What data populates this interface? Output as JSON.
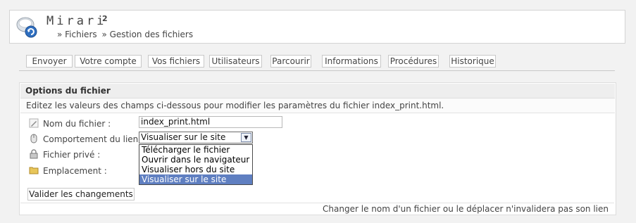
{
  "app": {
    "title": "Mirari",
    "superscript": "2"
  },
  "breadcrumb": [
    "» Fichiers",
    "» Gestion des fichiers"
  ],
  "tabs": [
    {
      "label": "Envoyer"
    },
    {
      "label": "Votre compte"
    },
    {
      "label": "Vos fichiers"
    },
    {
      "label": "Utilisateurs"
    },
    {
      "label": "Parcourir"
    },
    {
      "label": "Informations"
    },
    {
      "label": "Procédures"
    },
    {
      "label": "Historique"
    }
  ],
  "panel": {
    "title": "Options du fichier",
    "description": "Editez les valeurs des champs ci-dessous pour modifier les paramètres du fichier index_print.html.",
    "fields": {
      "filename": {
        "label": "Nom du fichier :",
        "value": "index_print.html",
        "icon": "pencil-icon"
      },
      "link_behavior": {
        "label": "Comportement du lien :",
        "icon": "mouse-icon",
        "selected": "Visualiser sur le site",
        "options": [
          "Télécharger le fichier",
          "Ouvrir dans le navigateur",
          "Visualiser hors du site",
          "Visualiser sur le site"
        ],
        "highlighted_index": 3
      },
      "private": {
        "label": "Fichier privé :",
        "icon": "lock-icon"
      },
      "location": {
        "label": "Emplacement :",
        "icon": "folder-icon"
      }
    },
    "submit_label": "Valider les changements",
    "footnote": "Changer le nom d'un fichier ou le déplacer n'invalidera pas son lien"
  },
  "colors": {
    "selection": "#5f7fc1",
    "background": "#f2f2f2"
  }
}
